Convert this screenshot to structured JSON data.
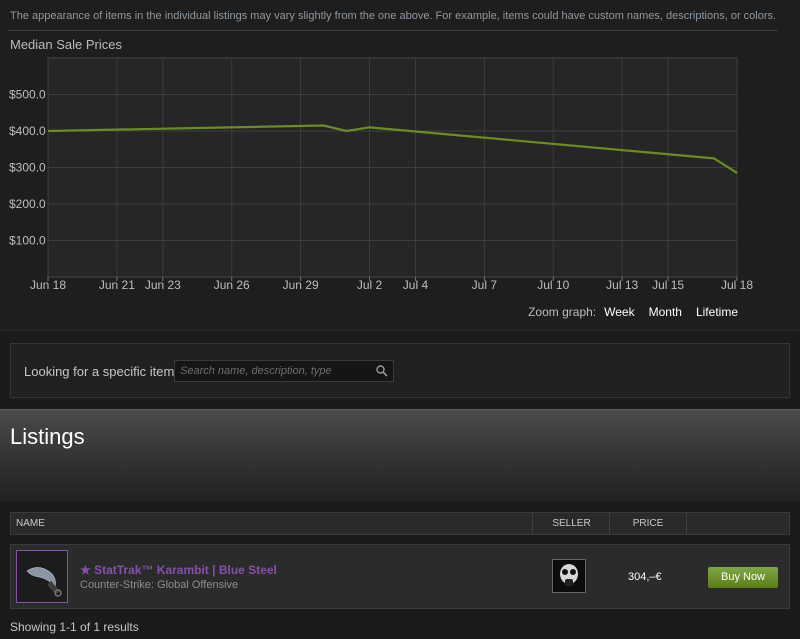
{
  "disclaimer": "The appearance of items in the individual listings may vary slightly from the one above. For example, items could have custom names, descriptions, or colors.",
  "chart_data": {
    "type": "line",
    "title": "Median Sale Prices",
    "x_ticks": [
      "Jun 18",
      "Jun 21",
      "Jun 23",
      "Jun 26",
      "Jun 29",
      "Jul 2",
      "Jul 4",
      "Jul 7",
      "Jul 10",
      "Jul 13",
      "Jul 15",
      "Jul 18"
    ],
    "y_ticks": [
      "$100.0",
      "$200.0",
      "$300.0",
      "$400.0",
      "$500.0"
    ],
    "ylim": [
      0,
      600
    ],
    "grid": true,
    "line_color": "#6b8e23",
    "series": [
      {
        "points": [
          {
            "x": "Jun 18",
            "y": 400
          },
          {
            "x": "Jun 30",
            "y": 415
          },
          {
            "x": "Jul 1",
            "y": 400
          },
          {
            "x": "Jul 2",
            "y": 410
          },
          {
            "x": "Jul 17",
            "y": 325
          },
          {
            "x": "Jul 18",
            "y": 285
          }
        ]
      }
    ]
  },
  "zoom": {
    "label": "Zoom graph:",
    "options": [
      "Week",
      "Month",
      "Lifetime"
    ]
  },
  "search": {
    "label": "Looking for a specific item?",
    "placeholder": "Search name, description, type"
  },
  "listings": {
    "title": "Listings",
    "columns": {
      "name": "NAME",
      "seller": "SELLER",
      "price": "PRICE"
    },
    "rows": [
      {
        "name": "★ StatTrak™ Karambit | Blue Steel",
        "game": "Counter-Strike: Global Offensive",
        "price": "304,–€",
        "buy_label": "Buy Now",
        "name_color": "#8650ac"
      }
    ],
    "results": "Showing 1-1 of 1 results"
  },
  "icons": {
    "search": "search-icon",
    "thumb": "karambit-knife-icon",
    "seller": "gas-mask-avatar-icon"
  }
}
